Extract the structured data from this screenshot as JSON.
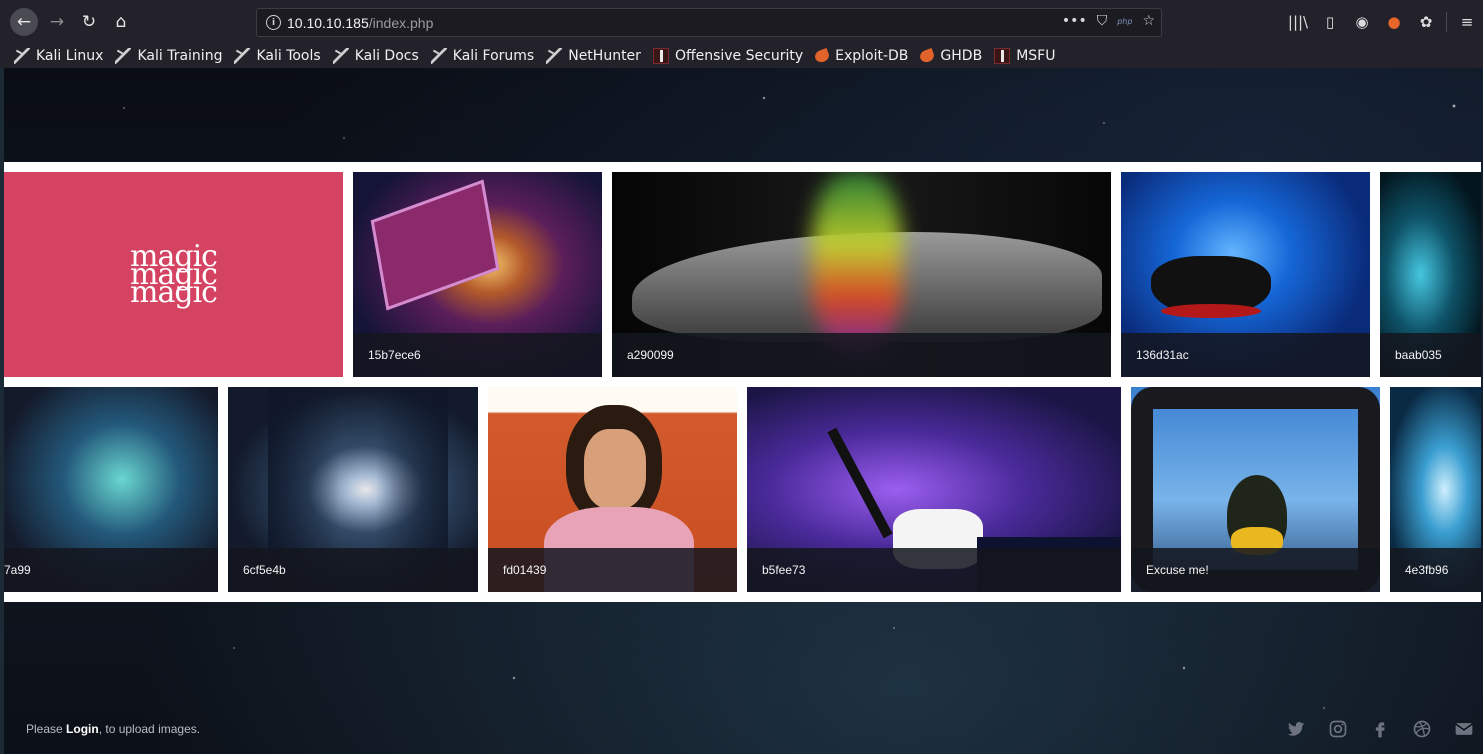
{
  "browser": {
    "url_host": "10.10.10.185",
    "url_path": "/index.php",
    "php_badge": "php"
  },
  "bookmarks": [
    {
      "label": "Kali Linux",
      "icon": "kali-dragon-icon"
    },
    {
      "label": "Kali Training",
      "icon": "kali-dragon-icon"
    },
    {
      "label": "Kali Tools",
      "icon": "kali-dragon-icon"
    },
    {
      "label": "Kali Docs",
      "icon": "kali-dragon-icon"
    },
    {
      "label": "Kali Forums",
      "icon": "kali-dragon-icon"
    },
    {
      "label": "NetHunter",
      "icon": "kali-dragon-icon"
    },
    {
      "label": "Offensive Security",
      "icon": "offsec-icon"
    },
    {
      "label": "Exploit-DB",
      "icon": "exploitdb-icon"
    },
    {
      "label": "GHDB",
      "icon": "exploitdb-icon"
    },
    {
      "label": "MSFU",
      "icon": "offsec-icon"
    }
  ],
  "gallery": {
    "row1": [
      {
        "caption": "",
        "art": "magic"
      },
      {
        "caption": "15b7ece6",
        "art": "book"
      },
      {
        "caption": "a290099",
        "art": "hand"
      },
      {
        "caption": "136d31ac",
        "art": "hat"
      },
      {
        "caption": "baab035",
        "art": "partial"
      }
    ],
    "row2": [
      {
        "caption": "7a99",
        "art": "smokehat"
      },
      {
        "caption": "6cf5e4b",
        "art": "galaxy"
      },
      {
        "caption": "fd01439",
        "art": "guy"
      },
      {
        "caption": "b5fee73",
        "art": "wand"
      },
      {
        "caption": "Excuse me!",
        "art": "duck"
      },
      {
        "caption": "4e3fb96",
        "art": "splash"
      }
    ]
  },
  "magic_logo_text": "magic",
  "footer": {
    "prefix": "Please ",
    "login_link": "Login",
    "suffix": ", to upload images."
  },
  "social": [
    "twitter-icon",
    "instagram-icon",
    "facebook-icon",
    "dribbble-icon",
    "email-icon"
  ]
}
